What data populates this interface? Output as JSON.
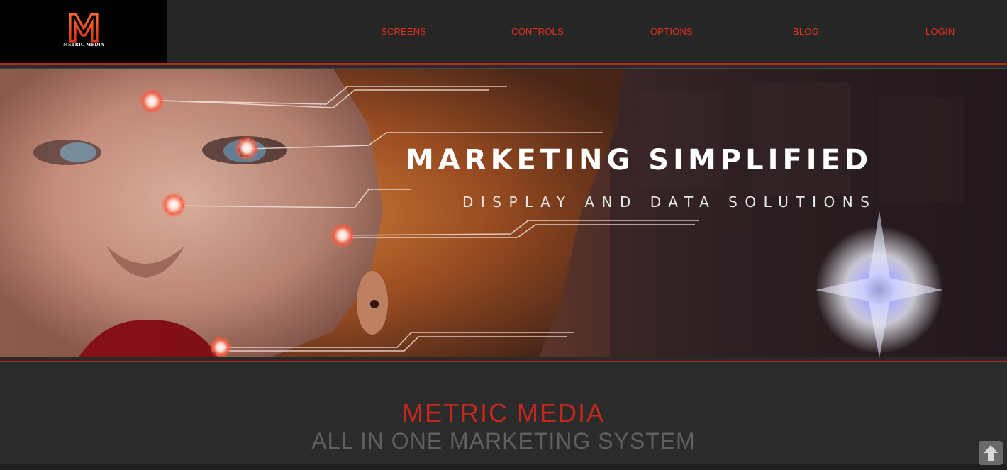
{
  "logo": {
    "letter": "M",
    "tm": "™",
    "name": "METRIC MEDIA"
  },
  "nav": {
    "items": [
      {
        "label": "SCREENS"
      },
      {
        "label": "CONTROLS"
      },
      {
        "label": "OPTIONS"
      },
      {
        "label": "BLOG"
      },
      {
        "label": "LOGIN"
      }
    ]
  },
  "hero": {
    "title": "MARKETING SIMPLIFIED",
    "subtitle": "DISPLAY AND DATA SOLUTIONS"
  },
  "main": {
    "title": "METRIC MEDIA",
    "subtitle": "ALL IN ONE MARKETING SYSTEM"
  },
  "colors": {
    "accent": "#e0301e",
    "header_bg": "#262626",
    "logo_bg": "#000000",
    "subtitle_gray": "#5f5f5f"
  },
  "icons": {
    "scroll_top": "up-arrow-icon"
  }
}
